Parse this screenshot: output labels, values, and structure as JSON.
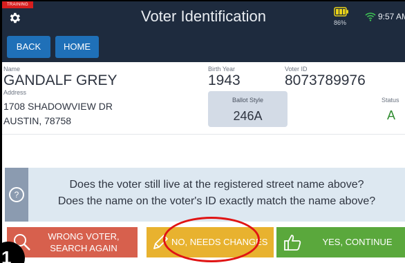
{
  "status_bar": {
    "training_label": "TRAINING",
    "battery_percent": "86%",
    "time": "9:57 AM",
    "gear_icon": "gear-icon",
    "battery_icon": "battery-icon",
    "wifi_icon": "wifi-icon"
  },
  "header": {
    "title": "Voter Identification"
  },
  "nav": {
    "back_label": "BACK",
    "home_label": "HOME"
  },
  "voter": {
    "name_label": "Name",
    "name": "GANDALF GREY",
    "birth_year_label": "Birth Year",
    "birth_year": "1943",
    "voter_id_label": "Voter ID",
    "voter_id": "8073789976",
    "address_label": "Address",
    "address_line1": "1708 SHADOWVIEW DR",
    "address_line2": "AUSTIN, 78758",
    "ballot_style_label": "Ballot Style",
    "ballot_style": "246A",
    "status_label": "Status",
    "status": "A"
  },
  "question": {
    "icon": "question-circle-icon",
    "line1": "Does the voter still live at the registered street name above?",
    "line2": "Does the name on the voter's ID exactly match the name above?"
  },
  "actions": {
    "wrong_voter_line1": "WRONG VOTER,",
    "wrong_voter_line2": "SEARCH AGAIN",
    "needs_changes": "NO, NEEDS CHANGES",
    "yes_continue": "YES, CONTINUE"
  },
  "colors": {
    "header_bg": "#1e2b3e",
    "nav_button": "#1f70b8",
    "wrong_button": "#d7604d",
    "changes_button": "#e8b22f",
    "continue_button": "#5aa83c",
    "status_green": "#2e8b2e",
    "annotation_red": "#e01414"
  },
  "annotation": {
    "step_number": "1"
  }
}
